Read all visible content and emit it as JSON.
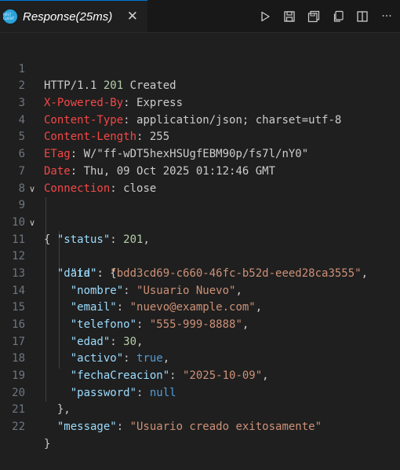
{
  "tab": {
    "icon_text": "REST CLIENT",
    "title": "Response(25ms)",
    "close": "✕"
  },
  "toolbar": {
    "icons": [
      "run-icon",
      "save-icon",
      "save-all-icon",
      "copy-icon",
      "split-editor-icon",
      "more-icon"
    ],
    "more": "···"
  },
  "colors": {
    "accent": "#0078d4",
    "header_key": "#f44747",
    "json_key": "#9cdcfe",
    "number": "#b5cea8",
    "string": "#ce9178",
    "keyword": "#569cd6"
  },
  "response": {
    "status_line": {
      "protocol": "HTTP/1.1",
      "code": "201",
      "reason": "Created"
    },
    "headers": [
      {
        "name": "X-Powered-By",
        "value": "Express"
      },
      {
        "name": "Content-Type",
        "value": "application/json; charset=utf-8"
      },
      {
        "name": "Content-Length",
        "value": "255"
      },
      {
        "name": "ETag",
        "value": "W/\"ff-wDT5hexHSUgfEBM90p/fs7l/nY0\""
      },
      {
        "name": "Date",
        "value": "Thu, 09 Oct 2025 01:12:46 GMT"
      },
      {
        "name": "Connection",
        "value": "close"
      }
    ],
    "body": {
      "status_key": "\"status\"",
      "status_value": "201",
      "data_key": "\"data\"",
      "fields": [
        {
          "key": "\"id\"",
          "value": "\"bdd3cd69-c660-46fc-b52d-eeed28ca3555\"",
          "type": "str"
        },
        {
          "key": "\"nombre\"",
          "value": "\"Usuario Nuevo\"",
          "type": "str"
        },
        {
          "key": "\"email\"",
          "value": "\"nuevo@example.com\"",
          "type": "str"
        },
        {
          "key": "\"telefono\"",
          "value": "\"555-999-8888\"",
          "type": "str"
        },
        {
          "key": "\"edad\"",
          "value": "30",
          "type": "num"
        },
        {
          "key": "\"activo\"",
          "value": "true",
          "type": "bool"
        },
        {
          "key": "\"fechaCreacion\"",
          "value": "\"2025-10-09\"",
          "type": "str"
        },
        {
          "key": "\"password\"",
          "value": "null",
          "type": "bool"
        }
      ],
      "message_key": "\"message\"",
      "message_value": "\"Usuario creado exitosamente\""
    }
  },
  "line_numbers": [
    "1",
    "2",
    "3",
    "4",
    "5",
    "6",
    "7",
    "8",
    "9",
    "10",
    "11",
    "12",
    "13",
    "14",
    "15",
    "16",
    "17",
    "18",
    "19",
    "20",
    "21",
    "22"
  ]
}
